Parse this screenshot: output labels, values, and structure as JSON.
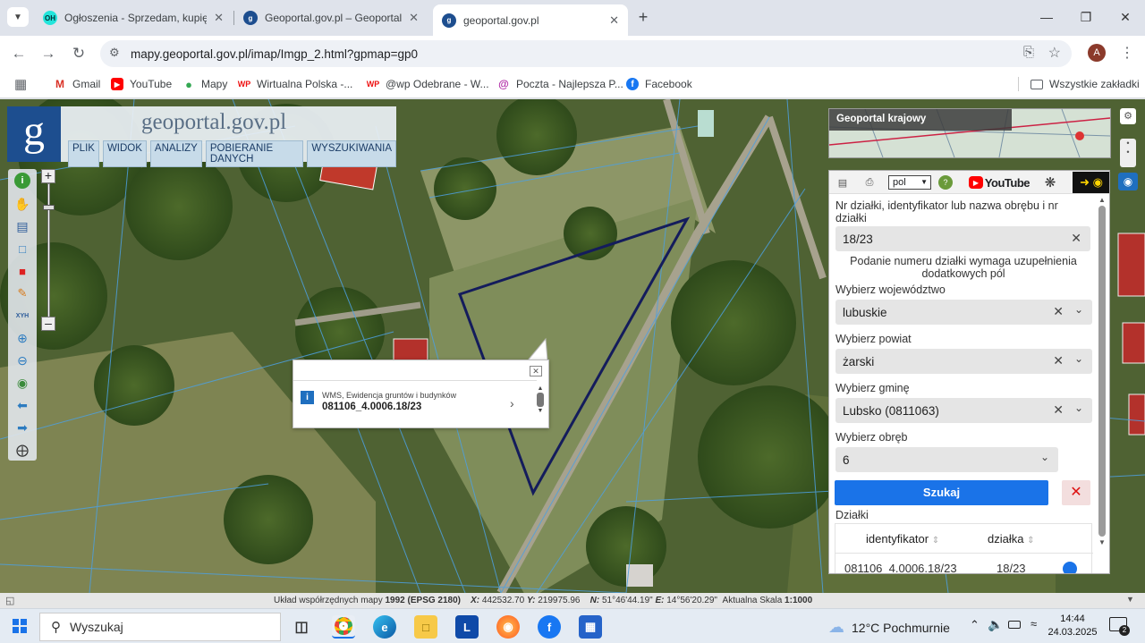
{
  "browser": {
    "tabs": [
      {
        "title": "Ogłoszenia - Sprzedam, kupię na",
        "favicon": "olx-icon",
        "active": false
      },
      {
        "title": "Geoportal.gov.pl – Geoportal Inf",
        "favicon": "geoportal-icon",
        "active": false
      },
      {
        "title": "geoportal.gov.pl",
        "favicon": "geoportal-icon",
        "active": true
      }
    ],
    "url": "mapy.geoportal.gov.pl/imap/Imgp_2.html?gpmap=gp0",
    "profile_initial": "A",
    "bookmarks": [
      {
        "label": "Gmail",
        "icon": "gmail-icon"
      },
      {
        "label": "YouTube",
        "icon": "youtube-icon"
      },
      {
        "label": "Mapy",
        "icon": "maps-pin-icon"
      },
      {
        "label": "Wirtualna Polska -...",
        "icon": "wp-icon"
      },
      {
        "label": "@wp Odebrane - W...",
        "icon": "wp-icon"
      },
      {
        "label": "Poczta - Najlepsza P...",
        "icon": "mail-icon"
      },
      {
        "label": "Facebook",
        "icon": "facebook-icon"
      }
    ],
    "all_bookmarks": "Wszystkie zakładki"
  },
  "map": {
    "logo_text": "geoportal.gov.pl",
    "menu": [
      "PLIK",
      "WIDOK",
      "ANALIZY",
      "POBIERANIE DANYCH",
      "WYSZUKIWANIA"
    ],
    "popup": {
      "layer": "WMS, Ewidencja gruntów i budynków",
      "parcel_id": "081106_4.0006.18/23"
    },
    "overview_title": "Geoportal krajowy",
    "lang": "pol",
    "xyh_label": "XYH"
  },
  "search_panel": {
    "field_label": "Nr działki, identyfikator lub nazwa obrębu i nr działki",
    "field_value": "18/23",
    "hint": "Podanie numeru działki wymaga uzupełnienia dodatkowych pól",
    "voivodeship_label": "Wybierz województwo",
    "voivodeship_value": "lubuskie",
    "county_label": "Wybierz powiat",
    "county_value": "żarski",
    "commune_label": "Wybierz gminę",
    "commune_value": "Lubsko (0811063)",
    "precinct_label": "Wybierz obręb",
    "precinct_value": "6",
    "search_button": "Szukaj",
    "results_label": "Działki",
    "col_identifier": "identyfikator",
    "col_parcel": "działka",
    "row_identifier": "081106_4.0006.18/23",
    "row_parcel": "18/23",
    "youtube_text": "YouTube"
  },
  "status": {
    "crs_label": "Układ współrzędnych mapy",
    "crs_value": "1992 (EPSG 2180)",
    "x": "442532.70",
    "y": "219975.96",
    "n": "51°46'44.19\"",
    "e": "14°56'20.29\"",
    "scale_label": "Aktualna Skala",
    "scale_value": "1:1000"
  },
  "taskbar": {
    "search_placeholder": "Wyszukaj",
    "weather": "12°C  Pochmurnie",
    "time": "14:44",
    "date": "24.03.2025"
  }
}
